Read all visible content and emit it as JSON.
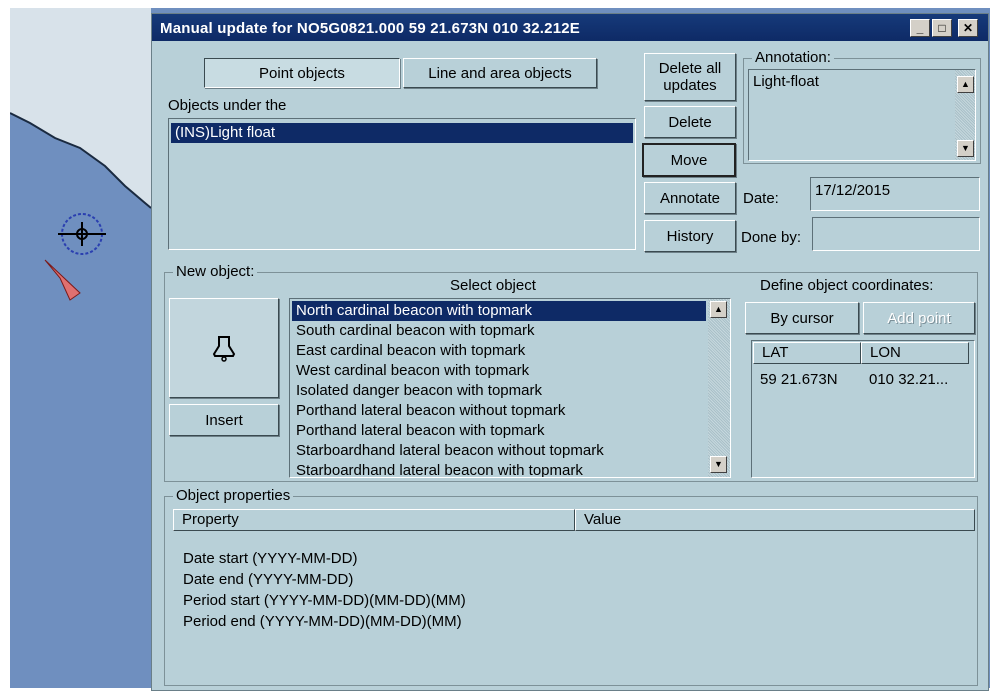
{
  "window": {
    "title": "Manual update for NO5G0821.000  59 21.673N  010 32.212E",
    "controls": [
      "minimize-icon",
      "maximize-icon",
      "close-icon"
    ]
  },
  "tabs": {
    "point": "Point objects",
    "line_area": "Line and area objects"
  },
  "objects_label": "Objects under the",
  "objects": [
    "(INS)Light float"
  ],
  "actions": {
    "delete_all_line1": "Delete all",
    "delete_all_line2": "updates",
    "delete": "Delete",
    "move": "Move",
    "annotate": "Annotate",
    "history": "History"
  },
  "annotation": {
    "label": "Annotation:",
    "value": "Light-float"
  },
  "date": {
    "label": "Date:",
    "value": "17/12/2015"
  },
  "done_by": {
    "label": "Done by:",
    "value": ""
  },
  "new_object": {
    "label": "New object:",
    "preview_icon": "bell-icon",
    "insert": "Insert",
    "select_label": "Select object",
    "options": [
      "North cardinal beacon with topmark",
      "South cardinal beacon with topmark",
      "East cardinal beacon with topmark",
      "West cardinal beacon with topmark",
      "Isolated danger beacon with topmark",
      "Porthand lateral beacon without topmark",
      "Porthand lateral beacon with topmark",
      "Starboardhand lateral beacon without topmark",
      "Starboardhand lateral beacon with topmark"
    ],
    "coords_label": "Define object coordinates:",
    "by_cursor": "By cursor",
    "add_point": "Add point",
    "coord_headers": [
      "LAT",
      "LON"
    ],
    "coord_rows": [
      [
        "59 21.673N",
        "010 32.21..."
      ]
    ]
  },
  "properties": {
    "label": "Object properties",
    "headers": [
      "Property",
      "Value"
    ],
    "rows": [
      "Date start (YYYY-MM-DD)",
      "Date end (YYYY-MM-DD)",
      "Period start (YYYY-MM-DD)(MM-DD)(MM)",
      "Period end (YYYY-MM-DD)(MM-DD)(MM)"
    ]
  },
  "colors": {
    "title_bar": "#0e2a66",
    "dialog_bg": "#b8d0d8",
    "chart_water": "#6f8fbf"
  }
}
